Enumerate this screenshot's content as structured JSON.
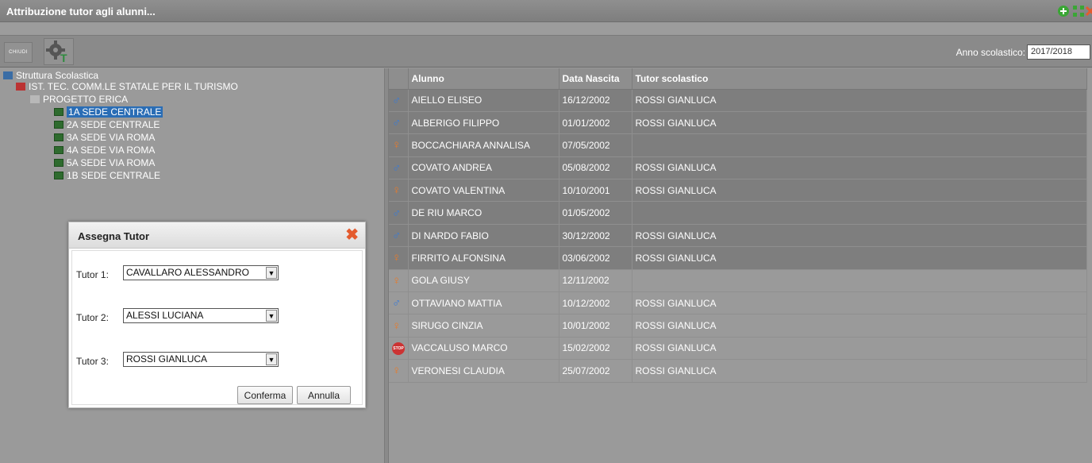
{
  "window": {
    "title": "Attribuzione tutor agli alunni...",
    "controls": [
      "plus-icon",
      "expand-icon",
      "close-icon"
    ]
  },
  "toolbar": {
    "chiudi_label": "CHIUDI",
    "tutor_icon": "tutor-gear-icon",
    "anno_label": "Anno scolastico:",
    "anno_value": "2017/2018"
  },
  "tree": {
    "root": "Struttura Scolastica",
    "school": "IST. TEC. COMM.LE STATALE PER IL TURISMO",
    "project": "PROGETTO ERICA",
    "classes": [
      "1A SEDE CENTRALE",
      "2A SEDE CENTRALE",
      "3A SEDE VIA ROMA",
      "4A SEDE VIA ROMA",
      "5A SEDE VIA ROMA",
      "1B SEDE CENTRALE"
    ],
    "selected_class": "1A SEDE CENTRALE"
  },
  "grid": {
    "columns": [
      "Alunno",
      "Data Nascita",
      "Tutor scolastico"
    ],
    "rows": [
      {
        "gender": "male",
        "alunno": "AIELLO ELISEO",
        "nascita": "16/12/2002",
        "tutor": "ROSSI GIANLUCA"
      },
      {
        "gender": "male",
        "alunno": "ALBERIGO FILIPPO",
        "nascita": "01/01/2002",
        "tutor": "ROSSI GIANLUCA"
      },
      {
        "gender": "female",
        "alunno": "BOCCACHIARA ANNALISA",
        "nascita": "07/05/2002",
        "tutor": ""
      },
      {
        "gender": "male",
        "alunno": "COVATO ANDREA",
        "nascita": "05/08/2002",
        "tutor": "ROSSI GIANLUCA"
      },
      {
        "gender": "female",
        "alunno": "COVATO VALENTINA",
        "nascita": "10/10/2001",
        "tutor": "ROSSI GIANLUCA"
      },
      {
        "gender": "male",
        "alunno": "DE RIU MARCO",
        "nascita": "01/05/2002",
        "tutor": ""
      },
      {
        "gender": "male",
        "alunno": "DI NARDO FABIO",
        "nascita": "30/12/2002",
        "tutor": "ROSSI GIANLUCA"
      },
      {
        "gender": "female",
        "alunno": "FIRRITO ALFONSINA",
        "nascita": "03/06/2002",
        "tutor": "ROSSI GIANLUCA"
      },
      {
        "gender": "female",
        "alunno": "GOLA GIUSY",
        "nascita": "12/11/2002",
        "tutor": ""
      },
      {
        "gender": "male",
        "alunno": "OTTAVIANO MATTIA",
        "nascita": "10/12/2002",
        "tutor": "ROSSI GIANLUCA"
      },
      {
        "gender": "female",
        "alunno": "SIRUGO CINZIA",
        "nascita": "10/01/2002",
        "tutor": "ROSSI GIANLUCA"
      },
      {
        "gender": "stop",
        "alunno": "VACCALUSO MARCO",
        "nascita": "15/02/2002",
        "tutor": "ROSSI GIANLUCA"
      },
      {
        "gender": "female",
        "alunno": "VERONESI CLAUDIA",
        "nascita": "25/07/2002",
        "tutor": "ROSSI GIANLUCA"
      }
    ],
    "selected_rows": 8,
    "stop_badge_text": "STOP"
  },
  "dialog": {
    "title": "Assegna Tutor",
    "tutor1_label": "Tutor 1:",
    "tutor1_value": "CAVALLARO ALESSANDRO",
    "tutor2_label": "Tutor 2:",
    "tutor2_value": "ALESSI LUCIANA",
    "tutor3_label": "Tutor 3:",
    "tutor3_value": "ROSSI GIANLUCA",
    "confirm_label": "Conferma",
    "cancel_label": "Annulla"
  },
  "colors": {
    "male": "#3a7bd5",
    "female": "#e87b2a",
    "selection": "#2a6db5",
    "close": "#e45b2e",
    "add": "#3aa635"
  }
}
